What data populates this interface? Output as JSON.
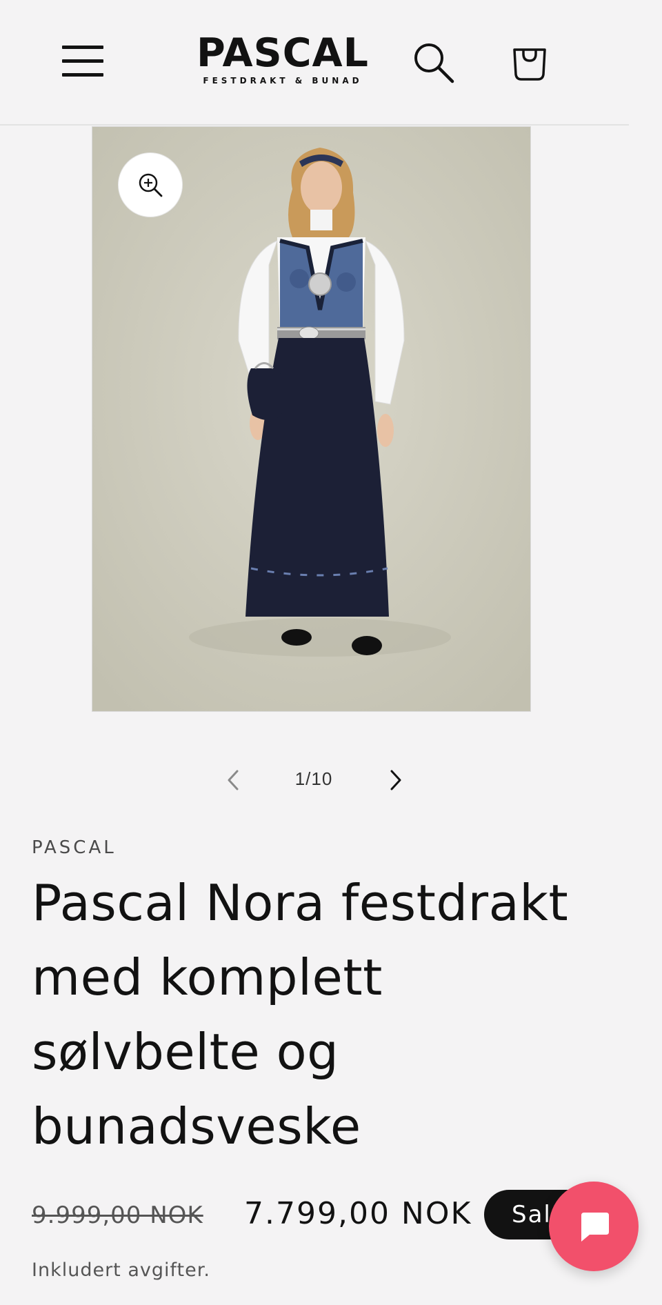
{
  "header": {
    "logo_name": "PASCAL",
    "logo_tagline": "FESTDRAKT & BUNAD"
  },
  "gallery": {
    "counter": "1/10",
    "current_slide": 1,
    "total_slides": 10
  },
  "product": {
    "vendor": "PASCAL",
    "title": "Pascal Nora festdrakt med komplett sølvbelte og bunadsveske",
    "regular_price": "9.999,00 NOK",
    "sale_price": "7.799,00 NOK",
    "sale_badge": "Salg",
    "tax_note": "Inkludert avgifter."
  },
  "colors": {
    "background": "#f4f3f4",
    "text": "#121212",
    "badge_bg": "#121212",
    "chat_button": "#f2506b"
  },
  "icons": [
    "menu-icon",
    "search-icon",
    "cart-icon",
    "zoom-icon",
    "chevron-left-icon",
    "chevron-right-icon",
    "chat-icon"
  ]
}
